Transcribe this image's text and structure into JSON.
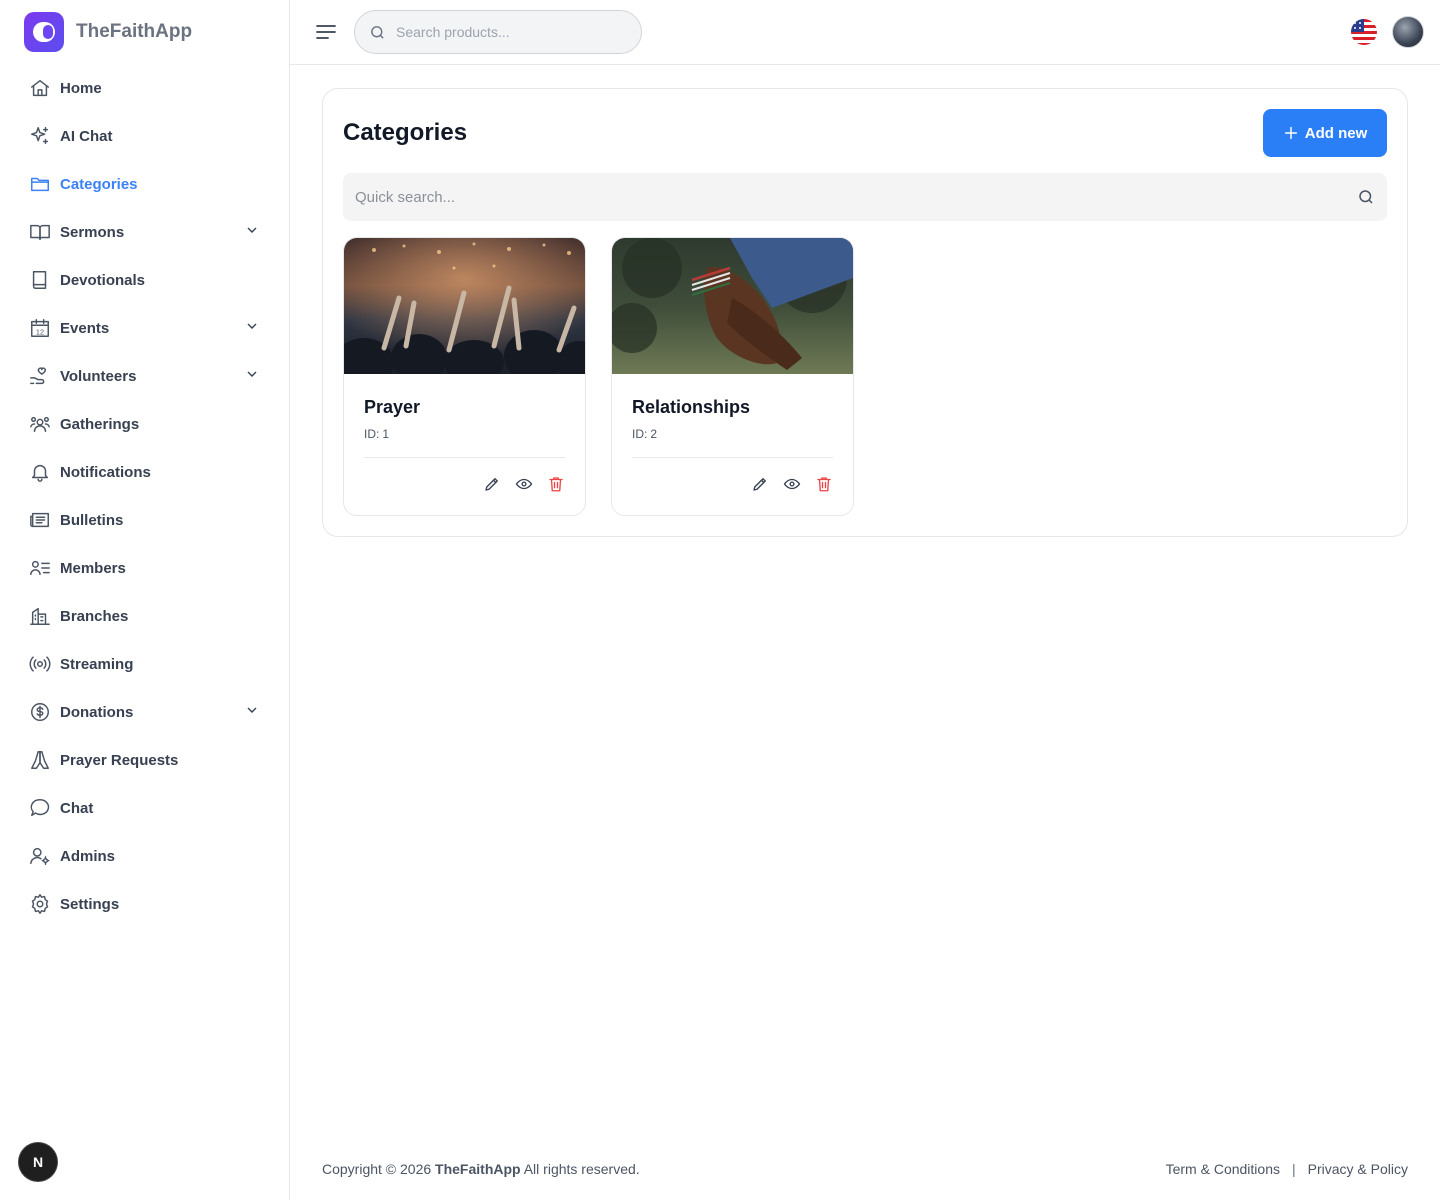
{
  "app": {
    "name": "TheFaithApp"
  },
  "sidebar": {
    "items": [
      {
        "label": "Home",
        "icon": "home-icon"
      },
      {
        "label": "AI Chat",
        "icon": "sparkle-icon"
      },
      {
        "label": "Categories",
        "icon": "folder-icon",
        "active": true
      },
      {
        "label": "Sermons",
        "icon": "book-open-icon",
        "expandable": true
      },
      {
        "label": "Devotionals",
        "icon": "book-icon"
      },
      {
        "label": "Events",
        "icon": "calendar-icon",
        "expandable": true
      },
      {
        "label": "Volunteers",
        "icon": "hand-heart-icon",
        "expandable": true
      },
      {
        "label": "Gatherings",
        "icon": "users-group-icon"
      },
      {
        "label": "Notifications",
        "icon": "bell-icon"
      },
      {
        "label": "Bulletins",
        "icon": "newspaper-icon"
      },
      {
        "label": "Members",
        "icon": "user-list-icon"
      },
      {
        "label": "Branches",
        "icon": "building-icon"
      },
      {
        "label": "Streaming",
        "icon": "broadcast-icon"
      },
      {
        "label": "Donations",
        "icon": "dollar-circle-icon",
        "expandable": true
      },
      {
        "label": "Prayer Requests",
        "icon": "praying-hands-icon"
      },
      {
        "label": "Chat",
        "icon": "chat-bubble-icon"
      },
      {
        "label": "Admins",
        "icon": "user-gear-icon"
      },
      {
        "label": "Settings",
        "icon": "gear-icon"
      }
    ],
    "calendar_day": "12",
    "next_badge": "N"
  },
  "header": {
    "search_placeholder": "Search products..."
  },
  "main": {
    "title": "Categories",
    "add_button": "Add new",
    "quick_search_placeholder": "Quick search...",
    "id_label": "ID:",
    "categories": [
      {
        "name": "Prayer",
        "id": "1"
      },
      {
        "name": "Relationships",
        "id": "2"
      }
    ]
  },
  "footer": {
    "copyright_prefix": "Copyright © 2026",
    "brand": "TheFaithApp",
    "copyright_suffix": "All rights reserved.",
    "terms": "Term & Conditions",
    "separator": "|",
    "privacy": "Privacy & Policy"
  },
  "colors": {
    "accent": "#2b7ff6",
    "active_nav": "#3b82f6",
    "brand_purple": "#6d46f2",
    "danger": "#ef4444"
  }
}
